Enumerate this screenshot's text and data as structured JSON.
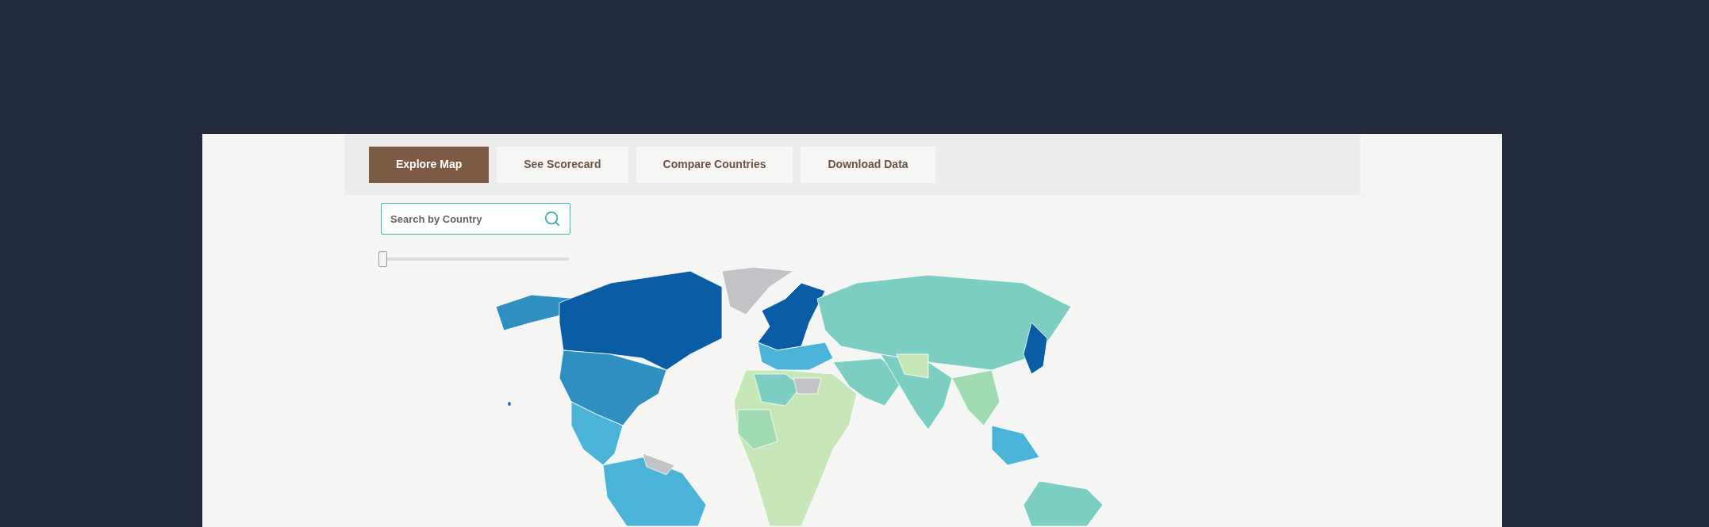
{
  "tabs": [
    {
      "label": "Explore Map",
      "selected": true
    },
    {
      "label": "See Scorecard",
      "selected": false
    },
    {
      "label": "Compare Countries",
      "selected": false
    },
    {
      "label": "Download Data",
      "selected": false
    }
  ],
  "search": {
    "placeholder": "Search by Country"
  },
  "slider": {
    "level": 0
  }
}
